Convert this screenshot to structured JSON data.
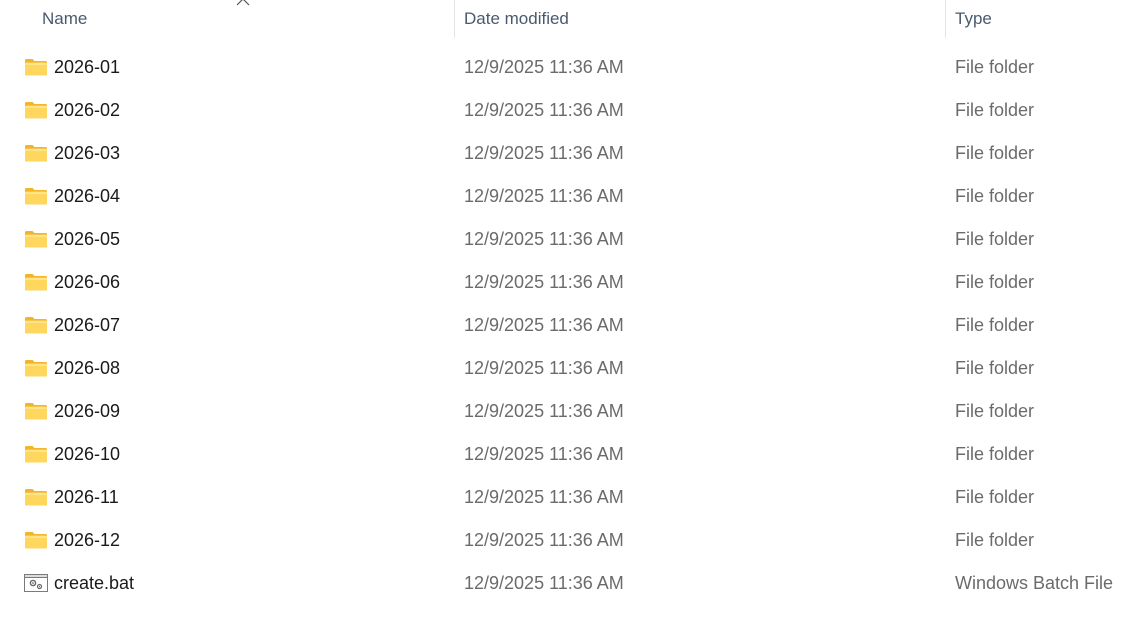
{
  "columns": {
    "name": "Name",
    "date_modified": "Date modified",
    "type": "Type"
  },
  "items": [
    {
      "name": "2026-01",
      "date_modified": "12/9/2025 11:36 AM",
      "type": "File folder",
      "icon": "folder-icon"
    },
    {
      "name": "2026-02",
      "date_modified": "12/9/2025 11:36 AM",
      "type": "File folder",
      "icon": "folder-icon"
    },
    {
      "name": "2026-03",
      "date_modified": "12/9/2025 11:36 AM",
      "type": "File folder",
      "icon": "folder-icon"
    },
    {
      "name": "2026-04",
      "date_modified": "12/9/2025 11:36 AM",
      "type": "File folder",
      "icon": "folder-icon"
    },
    {
      "name": "2026-05",
      "date_modified": "12/9/2025 11:36 AM",
      "type": "File folder",
      "icon": "folder-icon"
    },
    {
      "name": "2026-06",
      "date_modified": "12/9/2025 11:36 AM",
      "type": "File folder",
      "icon": "folder-icon"
    },
    {
      "name": "2026-07",
      "date_modified": "12/9/2025 11:36 AM",
      "type": "File folder",
      "icon": "folder-icon"
    },
    {
      "name": "2026-08",
      "date_modified": "12/9/2025 11:36 AM",
      "type": "File folder",
      "icon": "folder-icon"
    },
    {
      "name": "2026-09",
      "date_modified": "12/9/2025 11:36 AM",
      "type": "File folder",
      "icon": "folder-icon"
    },
    {
      "name": "2026-10",
      "date_modified": "12/9/2025 11:36 AM",
      "type": "File folder",
      "icon": "folder-icon"
    },
    {
      "name": "2026-11",
      "date_modified": "12/9/2025 11:36 AM",
      "type": "File folder",
      "icon": "folder-icon"
    },
    {
      "name": "2026-12",
      "date_modified": "12/9/2025 11:36 AM",
      "type": "File folder",
      "icon": "folder-icon"
    },
    {
      "name": "create.bat",
      "date_modified": "12/9/2025 11:36 AM",
      "type": "Windows Batch File",
      "icon": "batch-file-icon"
    }
  ],
  "colors": {
    "folder_front": "#FFD75E",
    "folder_back": "#F2B52A",
    "header_text": "#4a5a6e",
    "secondary_text": "#6b6b6b"
  }
}
